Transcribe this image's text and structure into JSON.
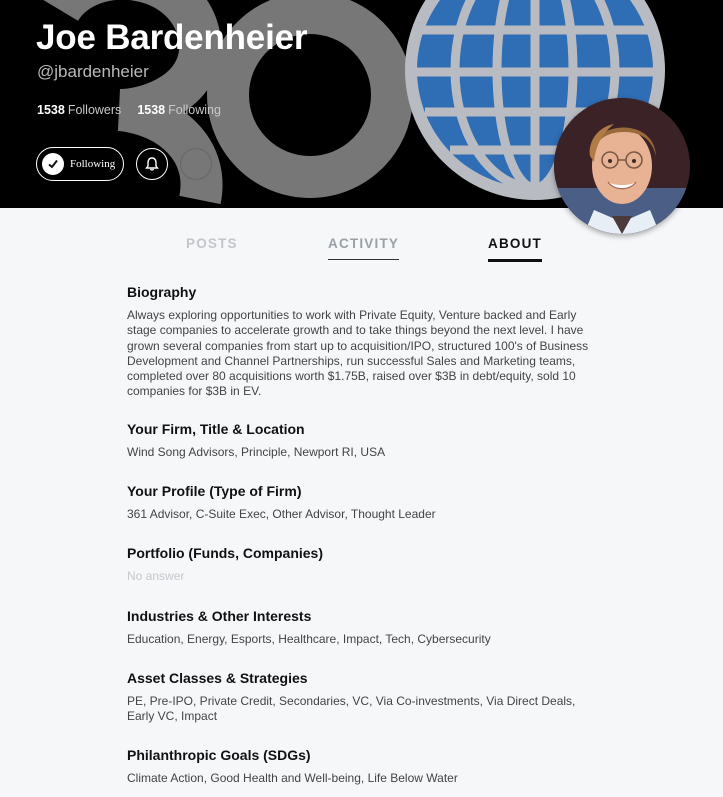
{
  "profile": {
    "name": "Joe Bardenheier",
    "handle": "@jbardenheier",
    "followers_count": "1538",
    "followers_label": "Followers",
    "following_count": "1538",
    "following_label": "Following"
  },
  "actions": {
    "follow_label": "Following"
  },
  "tabs": [
    {
      "label": "POSTS"
    },
    {
      "label": "ACTIVITY"
    },
    {
      "label": "ABOUT"
    }
  ],
  "sections": [
    {
      "title": "Biography",
      "text": "Always exploring opportunities to work with Private Equity, Venture backed and Early stage companies to accelerate growth and to take things beyond the next level. I have grown several companies from start up to acquisition/IPO, structured 100's of Business Development and Channel Partnerships, run successful Sales and Marketing teams, completed over 80 acquisitions worth $1.75B, raised over $3B in debt/equity, sold 10 companies for $3B in EV."
    },
    {
      "title": "Your Firm, Title & Location",
      "text": "Wind Song Advisors, Principle, Newport RI, USA"
    },
    {
      "title": "Your Profile (Type of Firm)",
      "text": "361 Advisor, C-Suite Exec, Other Advisor, Thought Leader"
    },
    {
      "title": "Portfolio (Funds, Companies)",
      "text": "No answer"
    },
    {
      "title": "Industries & Other Interests",
      "text": "Education, Energy, Esports, Healthcare, Impact, Tech, Cybersecurity"
    },
    {
      "title": "Asset Classes & Strategies",
      "text": "PE, Pre-IPO, Private Credit, Secondaries, VC, Via Co-investments, Via Direct Deals, Early VC, Impact"
    },
    {
      "title": "Philanthropic Goals (SDGs)",
      "text": "Climate Action, Good Health and Well-being, Life Below Water"
    }
  ],
  "colors": {
    "header_bg": "#000000",
    "globe_blue": "#2f6db5",
    "page_bg": "#f5f7f9"
  }
}
